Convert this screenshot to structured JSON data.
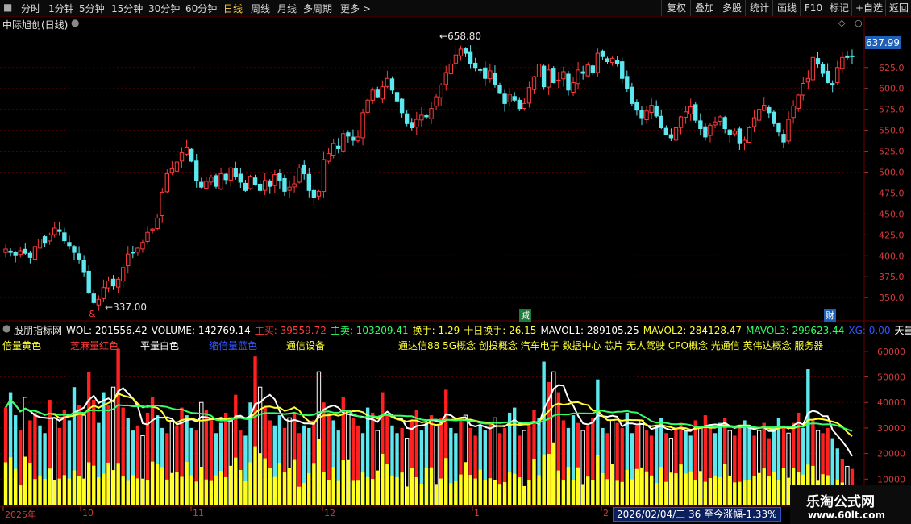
{
  "toolbar": {
    "periods": [
      "分时",
      "1分钟",
      "5分钟",
      "15分钟",
      "30分钟",
      "60分钟",
      "日线",
      "周线",
      "月线",
      "多周期",
      "更多 >"
    ],
    "active_period": "日线",
    "right_buttons": [
      "复权",
      "叠加",
      "多股",
      "统计",
      "画线",
      "F10",
      "标记",
      "+自选",
      "返回"
    ]
  },
  "main_chart": {
    "title": "中际旭创(日线)",
    "last_price": "637.99",
    "high_label": "658.80",
    "low_label": "337.00",
    "event_markers": [
      "&",
      "减",
      "财"
    ]
  },
  "indicator": {
    "name": "股朋指标网",
    "values": [
      {
        "label": "WOL:",
        "value": "201556.42",
        "color": "#ffffff"
      },
      {
        "label": "VOLUME:",
        "value": "142769.14",
        "color": "#ffffff"
      },
      {
        "label": "主买:",
        "value": "39559.72",
        "color": "#ff3b3b"
      },
      {
        "label": "主卖:",
        "value": "103209.41",
        "color": "#33ff66"
      },
      {
        "label": "换手:",
        "value": "1.29",
        "color": "#ffff33"
      },
      {
        "label": "十日换手:",
        "value": "26.15",
        "color": "#ffff33"
      },
      {
        "label": "MAVOL1:",
        "value": "289105.25",
        "color": "#ffffff"
      },
      {
        "label": "MAVOL2:",
        "value": "284128.47",
        "color": "#ffff33"
      },
      {
        "label": "MAVOL3:",
        "value": "299623.44",
        "color": "#33ff66"
      },
      {
        "label": "XG:",
        "value": "0.00",
        "color": "#3355ff"
      },
      {
        "label": "天量:",
        "value": "0.0",
        "color": "#ffffff"
      }
    ],
    "legend": [
      {
        "text": "倍量黄色",
        "color": "#ffff33"
      },
      {
        "text": "芝麻量红色",
        "color": "#ff3b3b"
      },
      {
        "text": "平量白色",
        "color": "#ffffff"
      },
      {
        "text": "缩倍量蓝色",
        "color": "#3355ff"
      },
      {
        "text": "通信设备",
        "color": "#ffff33"
      }
    ],
    "concepts": "通达信88 5G概念 创投概念 汽车电子 数据中心 芯片 无人驾驶 CPO概念 光通信 英伟达概念 服务器"
  },
  "x_axis": {
    "labels": [
      "2025年",
      "10",
      "11",
      "12",
      "1",
      "2"
    ]
  },
  "status": {
    "date_info": "2026/02/04/三 36 至今涨幅-1.33%"
  },
  "watermark": {
    "line1": "乐淘公式网",
    "line2": "www.60lt.com"
  },
  "colors": {
    "up": "#ff3b3b",
    "down": "#5ce8ee",
    "ma1": "#ffffff",
    "ma2": "#ffff33",
    "ma3": "#33ff66",
    "grid": "#4a0000",
    "axis_text": "#d23c3c"
  },
  "chart_data": [
    {
      "type": "candlestick",
      "title": "中际旭创(日线)",
      "y_ticks": [
        350,
        375,
        400,
        425,
        450,
        475,
        500,
        525,
        550,
        575,
        600,
        625
      ],
      "ylim": [
        328,
        672
      ],
      "closes": [
        408,
        404,
        401,
        406,
        403,
        398,
        411,
        420,
        415,
        425,
        433,
        429,
        418,
        412,
        404,
        396,
        380,
        356,
        344,
        348,
        362,
        370,
        364,
        372,
        386,
        402,
        404,
        409,
        416,
        428,
        432,
        445,
        476,
        498,
        504,
        512,
        523,
        530,
        513,
        490,
        482,
        489,
        494,
        483,
        498,
        491,
        505,
        495,
        488,
        478,
        495,
        485,
        478,
        490,
        483,
        497,
        490,
        477,
        482,
        486,
        505,
        498,
        478,
        470,
        477,
        515,
        522,
        534,
        528,
        546,
        543,
        538,
        542,
        571,
        586,
        598,
        590,
        602,
        612,
        598,
        585,
        571,
        558,
        553,
        563,
        568,
        566,
        576,
        590,
        604,
        619,
        629,
        640,
        647,
        642,
        630,
        625,
        622,
        612,
        621,
        605,
        595,
        582,
        593,
        586,
        576,
        582,
        601,
        614,
        629,
        602,
        622,
        607,
        610,
        620,
        598,
        607,
        622,
        618,
        628,
        619,
        642,
        638,
        632,
        636,
        630,
        612,
        600,
        582,
        574,
        565,
        573,
        580,
        567,
        553,
        545,
        541,
        553,
        566,
        572,
        578,
        562,
        552,
        542,
        556,
        560,
        566,
        552,
        545,
        549,
        534,
        538,
        553,
        565,
        575,
        580,
        571,
        558,
        548,
        536,
        563,
        579,
        592,
        606,
        612,
        637,
        629,
        618,
        607,
        604,
        625,
        637,
        637,
        638
      ],
      "ma_white_trend": "up",
      "high": 658.8,
      "low": 337.0
    },
    {
      "type": "bar",
      "title": "股朋指标网",
      "y_ticks": [
        10000,
        20000,
        30000,
        40000,
        50000,
        60000
      ],
      "ylim": [
        0,
        65000
      ],
      "volumes": [
        38000,
        44000,
        35000,
        29000,
        42000,
        33000,
        36000,
        31000,
        28000,
        41000,
        34000,
        30000,
        37000,
        33000,
        46000,
        39000,
        35000,
        52000,
        41000,
        32000,
        44000,
        39000,
        46000,
        61000,
        38000,
        34000,
        29000,
        31000,
        27000,
        36000,
        42000,
        35000,
        30000,
        28000,
        33000,
        31000,
        38000,
        35000,
        30000,
        29000,
        40000,
        37000,
        33000,
        28000,
        32000,
        36000,
        34000,
        43000,
        29000,
        27000,
        40000,
        58000,
        46000,
        38000,
        33000,
        31000,
        35000,
        30000,
        34000,
        36000,
        28000,
        31000,
        30000,
        33000,
        52000,
        40000,
        36000,
        33000,
        29000,
        42000,
        37000,
        34000,
        31000,
        28000,
        38000,
        36000,
        29000,
        44000,
        35000,
        31000,
        28000,
        30000,
        26000,
        33000,
        37000,
        29000,
        32000,
        35000,
        31000,
        34000,
        45000,
        30000,
        28000,
        33000,
        35000,
        30000,
        27000,
        31000,
        29000,
        32000,
        34000,
        28000,
        30000,
        36000,
        38000,
        27000,
        29000,
        31000,
        37000,
        34000,
        56000,
        48000,
        52000,
        44000,
        33000,
        30000,
        35000,
        32000,
        29000,
        31000,
        34000,
        49000,
        30000,
        28000,
        33000,
        32000,
        30000,
        36000,
        28000,
        31000,
        33000,
        29000,
        27000,
        31000,
        34000,
        28000,
        26000,
        30000,
        32000,
        29000,
        27000,
        33000,
        30000,
        35000,
        31000,
        28000,
        32000,
        34000,
        29000,
        27000,
        31000,
        33000,
        30000,
        27000,
        29000,
        32000,
        26000,
        30000,
        34000,
        31000,
        28000,
        32000,
        36000,
        30000,
        53000,
        33000,
        29000,
        28000,
        30000,
        26000,
        22000,
        18000,
        15000,
        14000
      ],
      "ma_lines": [
        "MAVOL1",
        "MAVOL2",
        "MAVOL3"
      ]
    }
  ]
}
